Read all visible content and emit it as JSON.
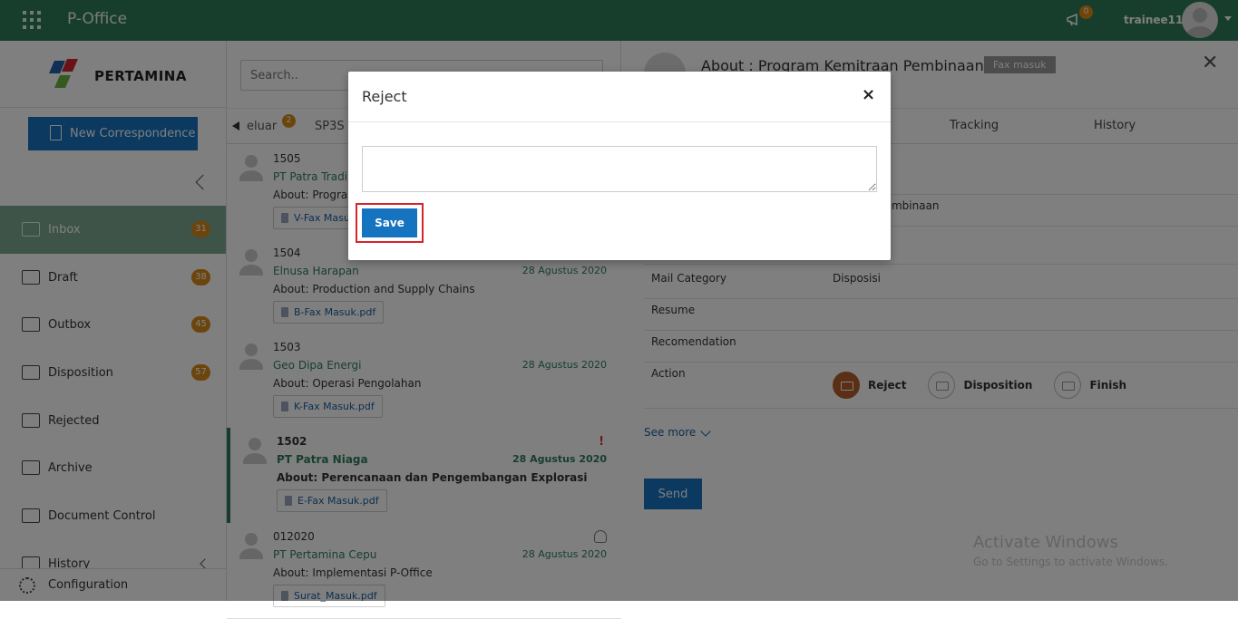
{
  "topbar": {
    "app_title": "P-Office",
    "notification_count": "0",
    "username": "trainee11"
  },
  "sidebar": {
    "logo_text": "PERTAMINA",
    "new_button": "New Correspondence",
    "items": [
      {
        "label": "Inbox",
        "badge": "31"
      },
      {
        "label": "Draft",
        "badge": "38"
      },
      {
        "label": "Outbox",
        "badge": "45"
      },
      {
        "label": "Disposition",
        "badge": "57"
      },
      {
        "label": "Rejected",
        "badge": ""
      },
      {
        "label": "Archive",
        "badge": ""
      },
      {
        "label": "Document Control",
        "badge": ""
      },
      {
        "label": "History",
        "badge": ""
      }
    ],
    "configuration": "Configuration"
  },
  "list": {
    "search_placeholder": "Search..",
    "tabs": [
      {
        "label": "eluar",
        "badge": "2"
      },
      {
        "label": "SP3S"
      }
    ],
    "messages": [
      {
        "number": "1505",
        "from": "PT Patra Trading",
        "date": "",
        "about": "About: Program",
        "attachment": "V-Fax Masuk"
      },
      {
        "number": "1504",
        "from": "Elnusa Harapan",
        "date": "28 Agustus 2020",
        "about": "About: Production and Supply Chains",
        "attachment": "B-Fax Masuk.pdf"
      },
      {
        "number": "1503",
        "from": "Geo Dipa Energi",
        "date": "28 Agustus 2020",
        "about": "About: Operasi Pengolahan",
        "attachment": "K-Fax Masuk.pdf"
      },
      {
        "number": "1502",
        "from": "PT Patra Niaga",
        "date": "28 Agustus 2020",
        "about": "About: Perencanaan dan Pengembangan Explorasi",
        "attachment": "E-Fax Masuk.pdf",
        "flag": "!"
      },
      {
        "number": "012020",
        "from": "PT Pertamina Cepu",
        "date": "28 Agustus 2020",
        "about": "About: Implementasi P-Office",
        "attachment": "Surat_Masuk.pdf"
      }
    ]
  },
  "detail": {
    "title": "About : Program Kemitraan Pembinaan",
    "badge": "Fax masuk",
    "tabs": [
      "Tracking",
      "History"
    ],
    "rows": [
      {
        "key": "",
        "value": "ding"
      },
      {
        "key": "",
        "value": "mitraan Pembinaan"
      },
      {
        "key": "",
        "value": ""
      },
      {
        "key": "Mail Category",
        "value": "Disposisi"
      },
      {
        "key": "Resume",
        "value": ""
      },
      {
        "key": "Recomendation",
        "value": ""
      },
      {
        "key": "Action",
        "value": ""
      }
    ],
    "actions": [
      "Reject",
      "Disposition",
      "Finish"
    ],
    "see_more": "See more",
    "send_button": "Send"
  },
  "watermark": {
    "line1": "Activate Windows",
    "line2": "Go to Settings to activate Windows."
  },
  "modal": {
    "title": "Reject",
    "close": "×",
    "input_value": "",
    "save_button": "Save"
  }
}
